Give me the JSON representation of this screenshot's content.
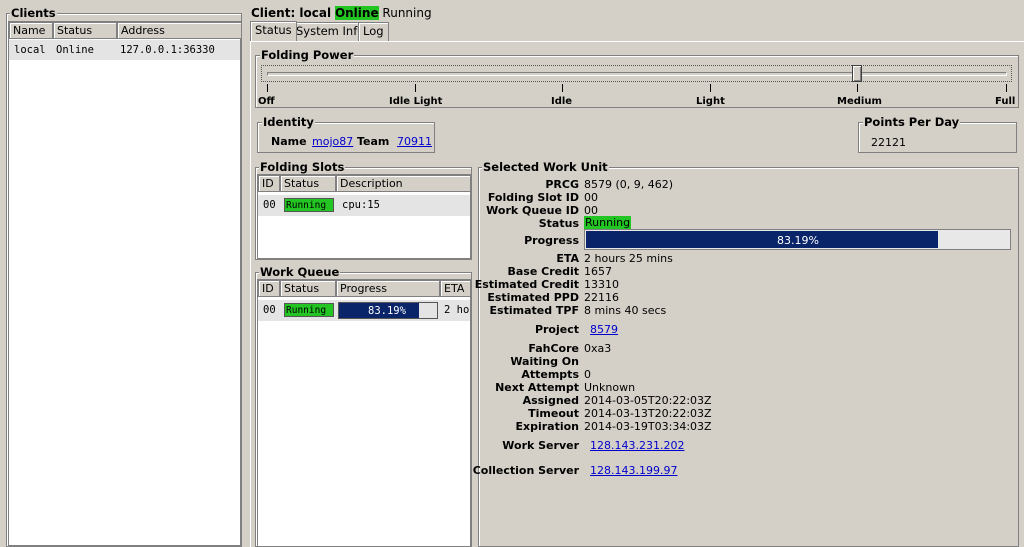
{
  "clients_panel": {
    "title": "Clients",
    "columns": [
      "Name",
      "Status",
      "Address"
    ],
    "rows": [
      {
        "name": "local",
        "status": "Online",
        "address": "127.0.0.1:36330"
      }
    ]
  },
  "client_header": {
    "prefix": "Client: local",
    "online": "Online",
    "status": "Running"
  },
  "tabs": [
    "Status",
    "System Info",
    "Log"
  ],
  "folding_power": {
    "title": "Folding Power",
    "ticks": [
      "Off",
      "Idle Light",
      "Idle",
      "Light",
      "Medium",
      "Full"
    ],
    "level_label": "Medium"
  },
  "identity": {
    "title": "Identity",
    "name_label": "Name",
    "name": "mojo87",
    "team_label": "Team",
    "team": "70911"
  },
  "ppd": {
    "title": "Points Per Day",
    "value": "22121"
  },
  "folding_slots": {
    "title": "Folding Slots",
    "columns": [
      "ID",
      "Status",
      "Description"
    ],
    "rows": [
      {
        "id": "00",
        "status": "Running",
        "description": "cpu:15"
      }
    ]
  },
  "work_queue": {
    "title": "Work Queue",
    "columns": [
      "ID",
      "Status",
      "Progress",
      "ETA"
    ],
    "rows": [
      {
        "id": "00",
        "status": "Running",
        "progress": "83.19%",
        "progress_fraction": 0.8319,
        "eta": "2 ho"
      }
    ]
  },
  "work_unit": {
    "title": "Selected Work Unit",
    "prcg_label": "PRCG",
    "prcg": "8579 (0, 9, 462)",
    "slot_label": "Folding Slot ID",
    "slot": "00",
    "queue_label": "Work Queue ID",
    "queue": "00",
    "status_label": "Status",
    "status": "Running",
    "progress_label": "Progress",
    "progress": "83.19%",
    "progress_fraction": 0.8319,
    "eta_label": "ETA",
    "eta": "2 hours 25 mins",
    "base_credit_label": "Base Credit",
    "base_credit": "1657",
    "est_credit_label": "Estimated Credit",
    "est_credit": "13310",
    "est_ppd_label": "Estimated PPD",
    "est_ppd": "22116",
    "est_tpf_label": "Estimated TPF",
    "est_tpf": "8 mins 40 secs",
    "project_label": "Project",
    "project": "8579",
    "fahcore_label": "FahCore",
    "fahcore": "0xa3",
    "waiting_label": "Waiting On",
    "waiting": "",
    "attempts_label": "Attempts",
    "attempts": "0",
    "next_attempt_label": "Next Attempt",
    "next_attempt": "Unknown",
    "assigned_label": "Assigned",
    "assigned": "2014-03-05T20:22:03Z",
    "timeout_label": "Timeout",
    "timeout": "2014-03-13T20:22:03Z",
    "expiration_label": "Expiration",
    "expiration": "2014-03-19T03:34:03Z",
    "work_server_label": "Work Server",
    "work_server": "128.143.231.202",
    "collection_server_label": "Collection Server",
    "collection_server": "128.143.199.97"
  },
  "colors": {
    "running": "#22c522",
    "progress_bar": "#0a246a",
    "link": "#0000cc"
  }
}
